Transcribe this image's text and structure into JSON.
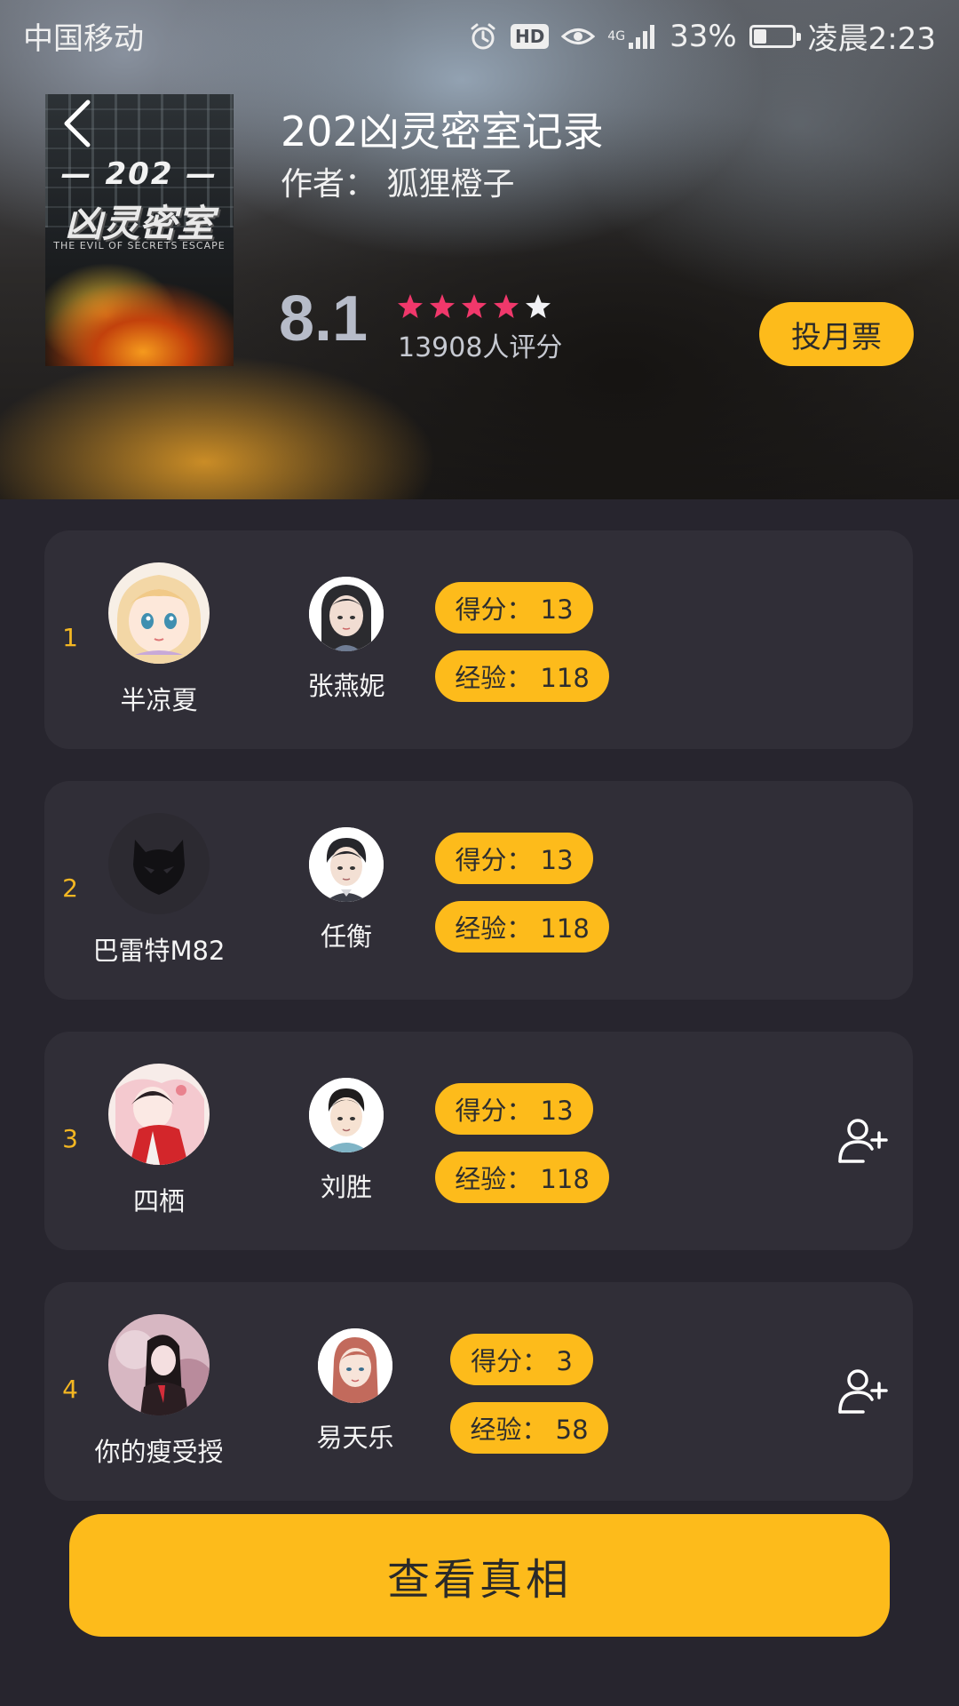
{
  "status_bar": {
    "carrier": "中国移动",
    "hd_label": "HD",
    "network": "4G",
    "battery_percent": "33%",
    "battery_level": 0.33,
    "time": "凌晨2:23"
  },
  "book": {
    "cover": {
      "number": "— 202 —",
      "title": "凶灵密室",
      "subtitle": "THE EVIL OF SECRETS ESCAPE"
    },
    "title": "202凶灵密室记录",
    "author": "作者： 狐狸橙子",
    "rating": "8.1",
    "stars": [
      1,
      1,
      1,
      1,
      0.5
    ],
    "rating_count": "13908人评分",
    "vote_label": "投月票"
  },
  "ranks": [
    {
      "rank": "1",
      "player": "半凉夏",
      "role": "张燕妮",
      "score": "得分： 13",
      "exp": "经验： 118",
      "show_add": false
    },
    {
      "rank": "2",
      "player": "巴雷特M82",
      "role": "任衡",
      "score": "得分： 13",
      "exp": "经验： 118",
      "show_add": false
    },
    {
      "rank": "3",
      "player": "四栖",
      "role": "刘胜",
      "score": "得分： 13",
      "exp": "经验： 118",
      "show_add": true
    },
    {
      "rank": "4",
      "player": "你的瘦受授",
      "role": "易天乐",
      "score": "得分： 3",
      "exp": "经验： 58",
      "show_add": true
    }
  ],
  "main_button_label": "查看真相",
  "colors": {
    "accent": "#fdbb1b",
    "background": "#27252e",
    "card": "#302e37",
    "star": "#f0386b",
    "rank_number": "#f4b722"
  }
}
